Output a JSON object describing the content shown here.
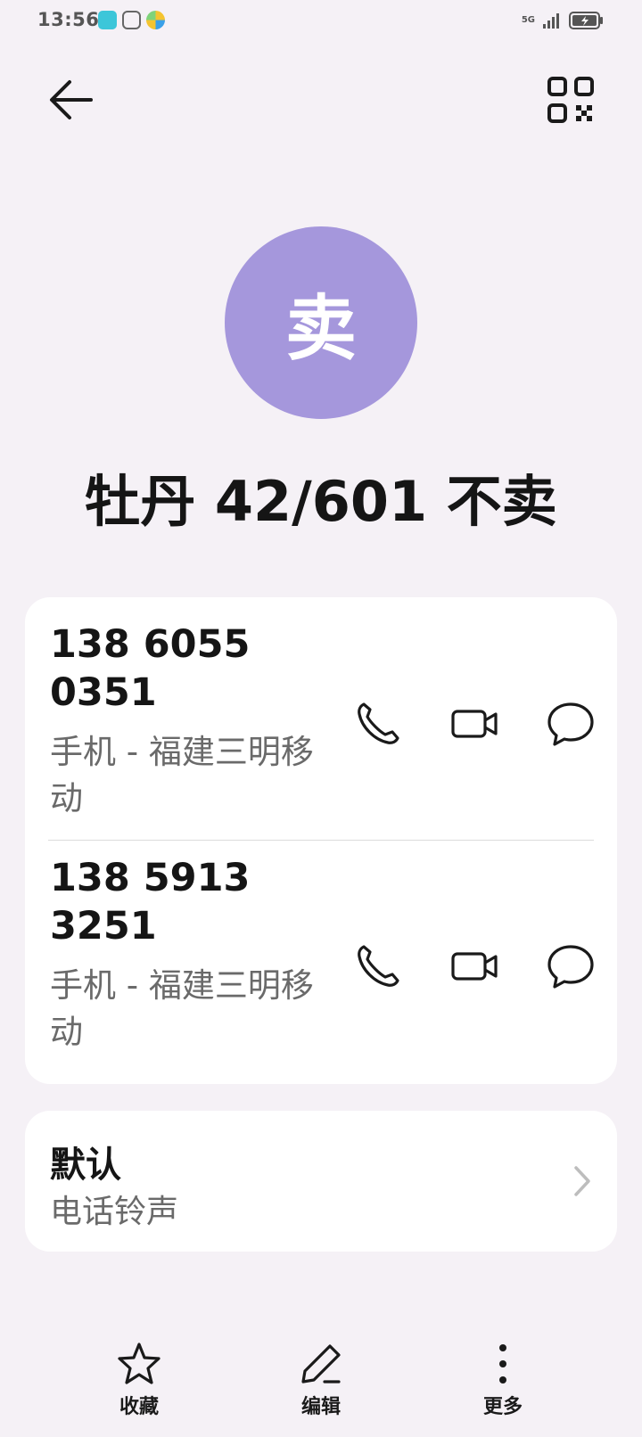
{
  "status_bar": {
    "time": "13:56",
    "network": "5G"
  },
  "header": {
    "back_icon": "arrow-left-icon",
    "qr_icon": "qr-code-icon"
  },
  "contact": {
    "avatar_letter": "卖",
    "avatar_color": "#a597dc",
    "name": "牡丹 42/601 不卖"
  },
  "phones": [
    {
      "number": "138 6055 0351",
      "label": "手机 - 福建三明移动"
    },
    {
      "number": "138 5913 3251",
      "label": "手机 - 福建三明移动"
    }
  ],
  "ringtone": {
    "title": "默认",
    "subtitle": "电话铃声"
  },
  "bottom_bar": {
    "favorite": "收藏",
    "edit": "编辑",
    "more": "更多"
  }
}
